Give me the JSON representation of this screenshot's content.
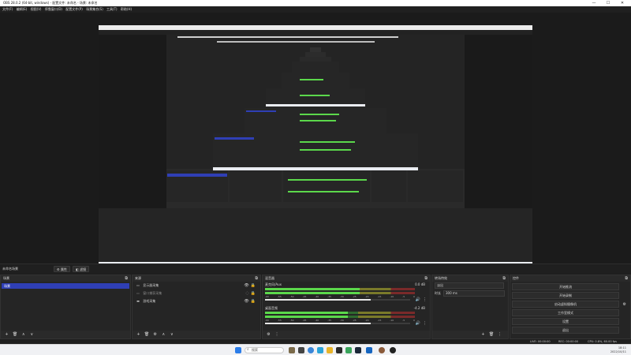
{
  "window": {
    "title": "OBS 28.0.2 (64-bit, windows) - 配置文件: 未命名 - 场景: 未命名",
    "minimize": "—",
    "maximize": "☐",
    "close": "✕"
  },
  "menu": [
    "文件(F)",
    "编辑(E)",
    "视图(V)",
    "停靠窗口(D)",
    "配置文件(P)",
    "场景集合(S)",
    "工具(T)",
    "帮助(H)"
  ],
  "scene_line": {
    "label": "未命名场景",
    "btn1": "⚙ 属性",
    "btn2": "◧ 滤镜"
  },
  "docks": {
    "scenes": {
      "title": "场景",
      "items": [
        "场景"
      ],
      "footer": [
        "+",
        "🗑",
        "∧",
        "∨"
      ]
    },
    "sources": {
      "title": "来源",
      "items": [
        {
          "icon": "▭",
          "label": "显示器采集"
        },
        {
          "icon": "▭",
          "label": "窗口捕获采集"
        },
        {
          "icon": "▬",
          "label": "游戏采集"
        }
      ],
      "footer": [
        "+",
        "🗑",
        "⚙",
        "∧",
        "∨"
      ]
    },
    "mixer": {
      "title": "混音器",
      "channels": [
        {
          "name": "麦克风/Aux",
          "db": "0.0 dB",
          "level": 0.63,
          "volume": 0.73
        },
        {
          "name": "桌面音频",
          "db": "-4.2 dB",
          "level": 0.55,
          "volume": 0.73
        }
      ],
      "ticks": [
        "-60",
        "-55",
        "-50",
        "-45",
        "-40",
        "-35",
        "-30",
        "-25",
        "-20",
        "-15",
        "-10",
        "-5",
        "0"
      ],
      "footer": [
        "⚙",
        "⋮"
      ]
    },
    "transitions": {
      "title": "转场特效",
      "type": "淡出",
      "duration_label": "时长",
      "duration": "300 ms",
      "footer": [
        "+",
        "🗑",
        "⋮"
      ]
    },
    "controls": {
      "title": "控件",
      "buttons": [
        "开始推流",
        "开始录制",
        "启动虚拟摄像机",
        "工作室模式",
        "设置",
        "退出"
      ]
    }
  },
  "status": {
    "live": "LIVE: 00:00:00",
    "rec": "REC: 00:00:00",
    "cpu": "CPU: 0.8%, 60.00 fps"
  },
  "taskbar": {
    "search_placeholder": "搜索",
    "time": "18:11",
    "date": "2022/10/11"
  },
  "colors": {
    "accent": "#2f3fb5",
    "meter_green": "#5bd84b"
  }
}
